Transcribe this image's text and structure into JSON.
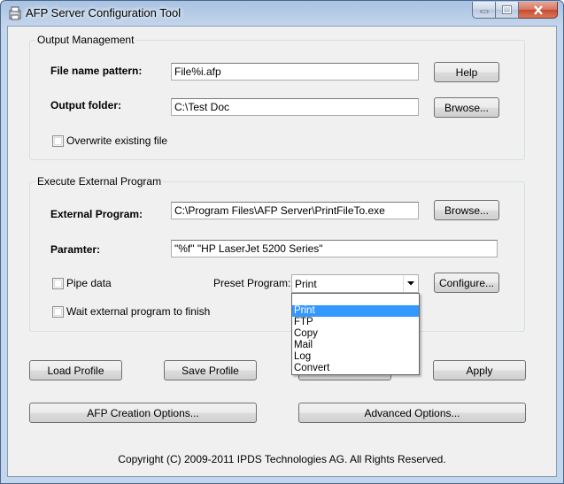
{
  "window": {
    "title": "AFP Server Configuration Tool"
  },
  "output_management": {
    "group_label": "Output Management",
    "file_name_pattern_label": "File name pattern:",
    "file_name_pattern_value": "File%i.afp",
    "help_button": "Help",
    "output_folder_label": "Output folder:",
    "output_folder_value": "C:\\Test Doc",
    "browse_button": "Brwose...",
    "overwrite_label": "Overwrite existing file",
    "overwrite_checked": false
  },
  "execute_external": {
    "group_label": "Execute External Program",
    "external_program_label": "External Program:",
    "external_program_value": "C:\\Program Files\\AFP Server\\PrintFileTo.exe",
    "browse_button": "Browse...",
    "parameter_label": "Paramter:",
    "parameter_value": "\"%f\" \"HP LaserJet 5200 Series\"",
    "pipe_data_label": "Pipe data",
    "pipe_data_checked": false,
    "preset_program_label": "Preset Program:",
    "preset_program_selected": "Print",
    "preset_program_options": [
      "",
      "Print",
      "FTP",
      "Copy",
      "Mail",
      "Log",
      "Convert"
    ],
    "configure_button": "Configure...",
    "wait_label": "Wait external program to finish",
    "wait_checked": false
  },
  "buttons": {
    "load_profile": "Load Profile",
    "save_profile": "Save Profile",
    "apply": "Apply",
    "afp_creation_options": "AFP Creation Options...",
    "advanced_options": "Advanced Options..."
  },
  "footer": {
    "copyright": "Copyright (C) 2009-2011 IPDS Technologies AG. All Rights Reserved."
  }
}
